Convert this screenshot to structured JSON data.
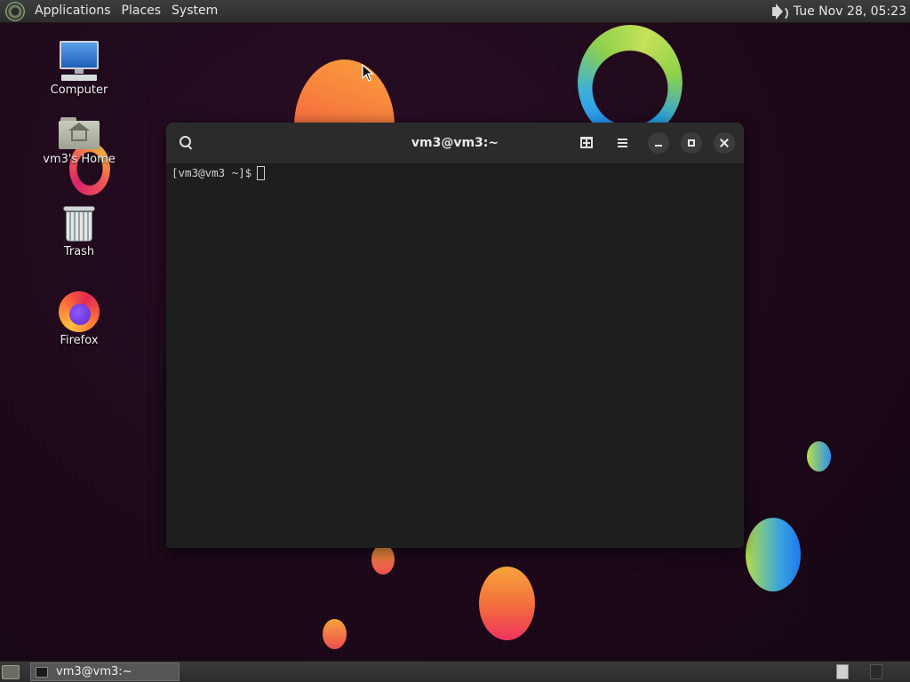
{
  "top_panel": {
    "menus": [
      "Applications",
      "Places",
      "System"
    ],
    "clock": "Tue Nov 28, 05:23",
    "icons": {
      "logo": "distro-logo-icon",
      "volume": "volume-icon"
    }
  },
  "desktop": {
    "icons": [
      {
        "label": "Computer",
        "icon": "computer-icon"
      },
      {
        "label": "vm3's Home",
        "icon": "home-folder-icon"
      },
      {
        "label": "Trash",
        "icon": "trash-icon"
      },
      {
        "label": "Firefox",
        "icon": "firefox-icon"
      }
    ]
  },
  "terminal": {
    "title": "vm3@vm3:~",
    "prompt": "[vm3@vm3 ~]$",
    "icons": {
      "search": "search-icon",
      "new_tab": "new-tab-icon",
      "menu": "hamburger-menu-icon",
      "minimize": "minimize-icon",
      "maximize": "maximize-icon",
      "close": "close-icon"
    },
    "colors": {
      "background": "#1e1e1e",
      "header": "#2b2b2b",
      "text": "#d0d0d0"
    }
  },
  "bottom_panel": {
    "taskbar_items": [
      {
        "label": "vm3@vm3:~",
        "icon": "terminal-icon"
      }
    ],
    "workspaces": 2,
    "active_workspace": 1
  }
}
